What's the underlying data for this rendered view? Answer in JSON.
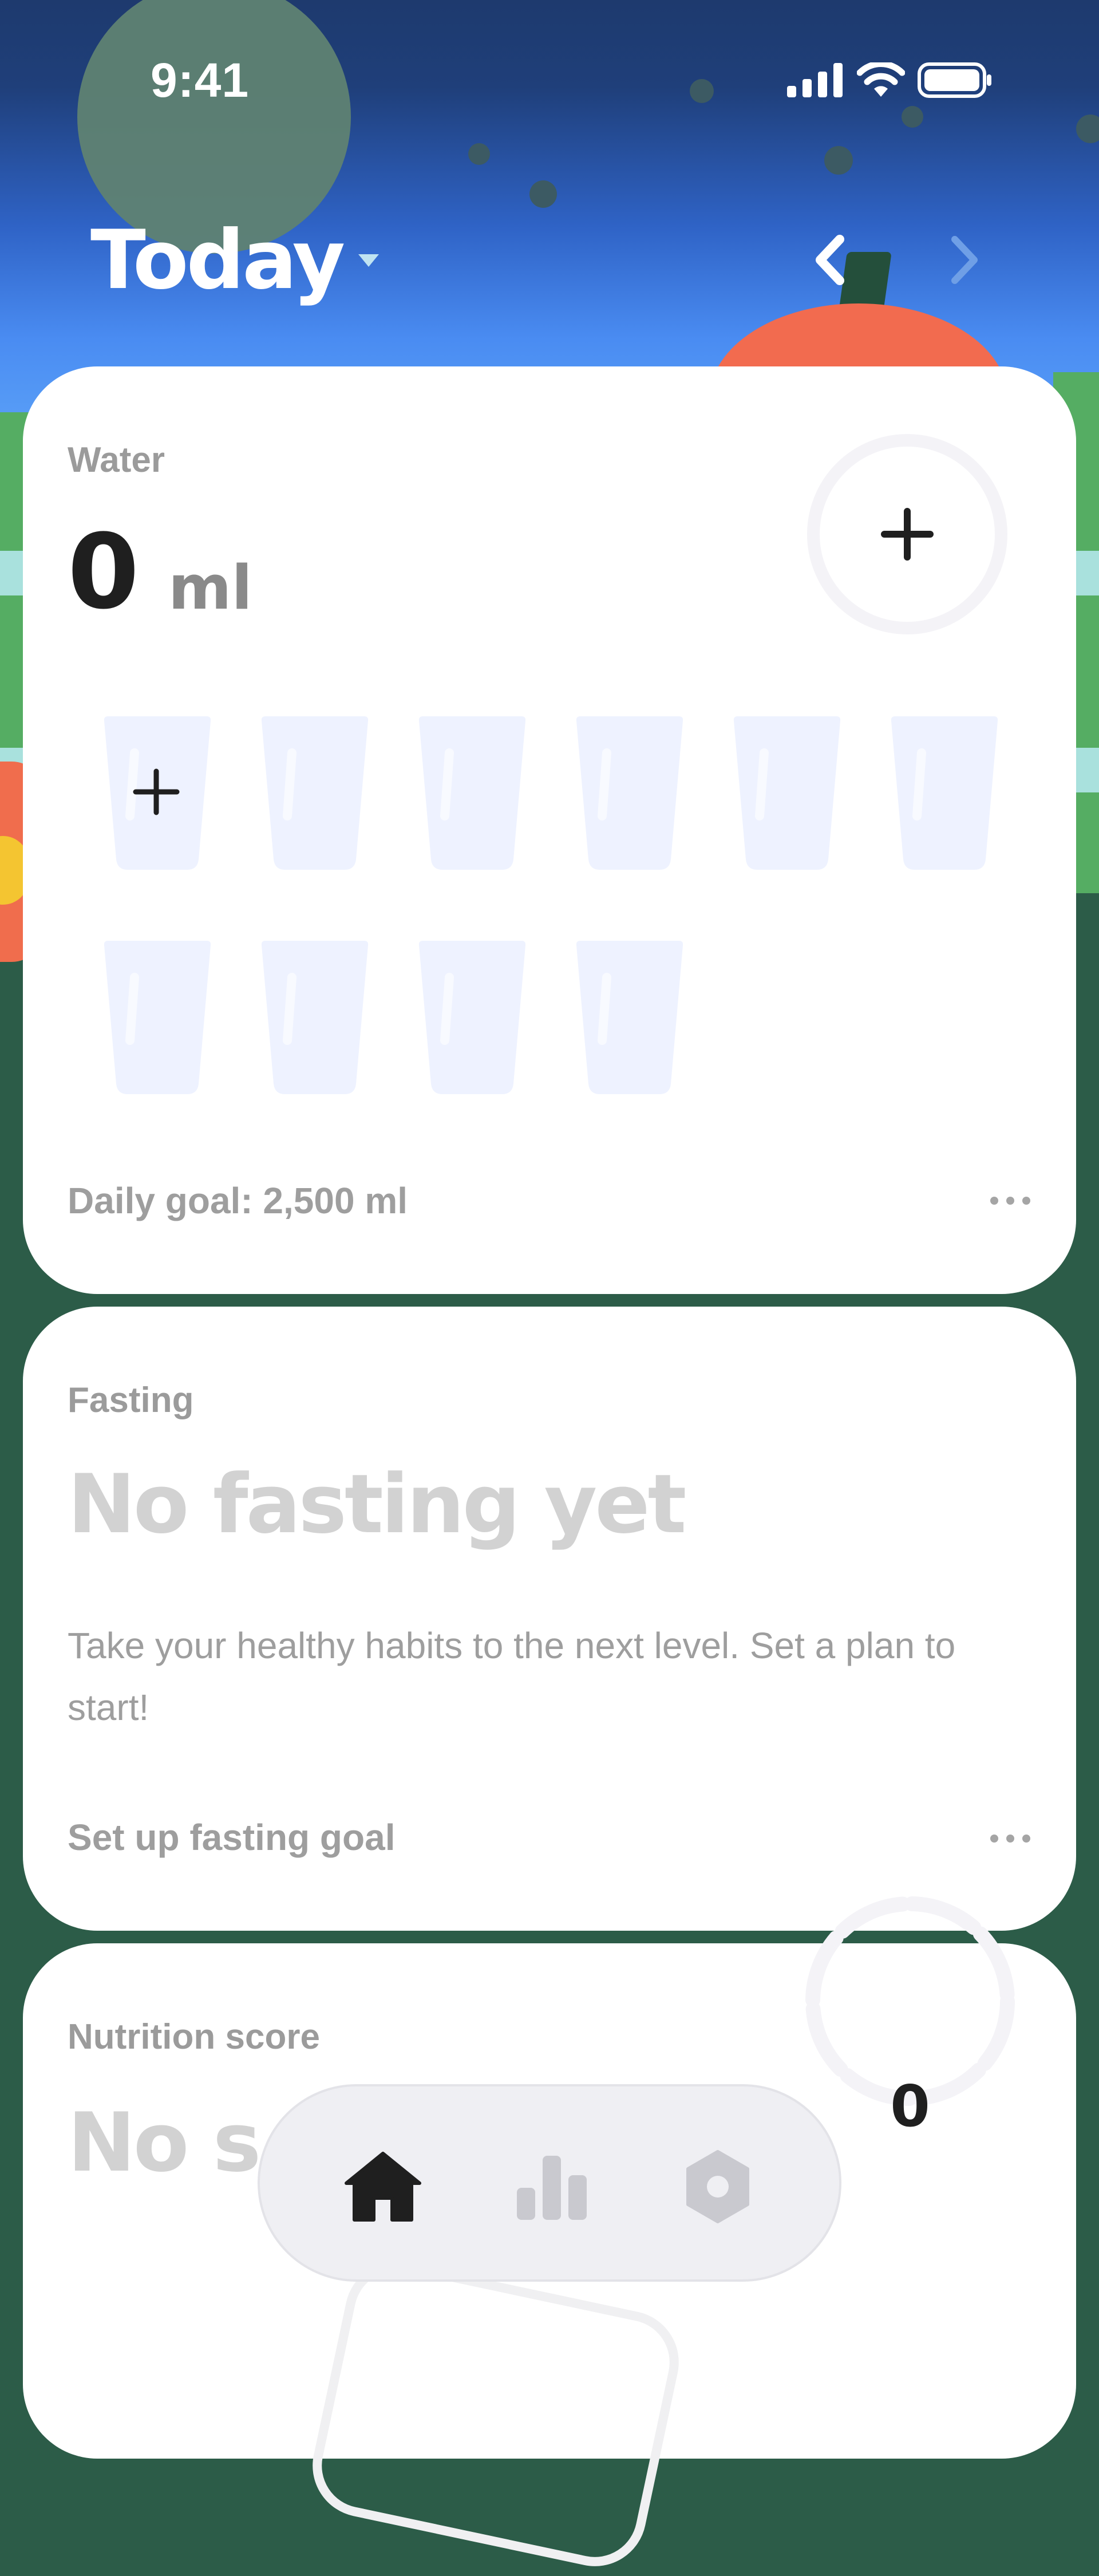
{
  "status": {
    "time": "9:41"
  },
  "header": {
    "title": "Today"
  },
  "water": {
    "label": "Water",
    "value": "0",
    "unit": "ml",
    "goal_text": "Daily goal: 2,500 ml",
    "glasses_total": 10,
    "glasses_filled": 0
  },
  "fasting": {
    "label": "Fasting",
    "title": "No fasting yet",
    "description": "Take your healthy habits to the next level. Set a plan to start!",
    "footer": "Set up fasting goal"
  },
  "nutrition": {
    "label": "Nutrition score",
    "title_visible": "No s",
    "score": "0"
  },
  "tabbar": {
    "tabs": [
      {
        "icon": "home-icon",
        "active": true
      },
      {
        "icon": "stats-icon",
        "active": false
      },
      {
        "icon": "settings-icon",
        "active": false
      }
    ]
  },
  "colors": {
    "card_bg": "#ffffff",
    "glass_fill": "#eef2ff",
    "ground": "#2c5c48",
    "sky_top": "#1e3a6e",
    "sky_bottom": "#5aa0f7"
  }
}
